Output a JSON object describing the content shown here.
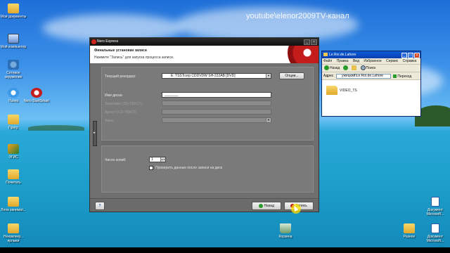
{
  "watermark": "youtube\\elenor2009TV-канал",
  "desktop_icons": [
    {
      "label": "Мои документы"
    },
    {
      "label": "Мой компьютер"
    },
    {
      "label": "Сетевое окружение"
    },
    {
      "label": "iTunes"
    },
    {
      "label": "Nero StartSmart"
    },
    {
      "label": "Прогр"
    },
    {
      "label": "ЭГИС"
    },
    {
      "label": "Почитать"
    },
    {
      "label": "Лена занимат..."
    },
    {
      "label": "Неизвлеку... ярлыки"
    },
    {
      "label": "Корзина"
    },
    {
      "label": "Разное"
    },
    {
      "label": "Документ Microsoft..."
    },
    {
      "label": "Документ Microsoft..."
    }
  ],
  "nero": {
    "title": "Nero Express",
    "header_title": "Финальные установки записи",
    "header_subtitle": "Нажмите \"Запись\" для запуска процесса записи.",
    "recorder_label": "Текущий рекордер:",
    "recorder_value": "E: TSSTcorp CDDVDW SH-222AB   [DVD]",
    "options_button": "Опции...",
    "disc_name_label": "Имя диска:",
    "disc_name_value": "_______",
    "title_label": "Заголовок (CD-ТЕКСТ)",
    "artist_label": "Артист (CD-ТЕКСТ)",
    "lang_label": "Язык:",
    "copies_label": "Число копий:",
    "copies_value": "1",
    "verify_label": "Проверить данные после записи на диск",
    "help_button": "?",
    "back_button": "Назад",
    "burn_button": "Запись"
  },
  "explorer": {
    "title": "Le.Roi.de.Lahore",
    "menu": [
      "Файл",
      "Правка",
      "Вид",
      "Избранное",
      "Сервис",
      "Справка"
    ],
    "toolbar": {
      "back": "Назад",
      "search": "Поиск"
    },
    "address_label": "Адрес",
    "address_value": "ужецкий\\Le.Roi.de.Lahore",
    "go_button": "Переход",
    "folder_name": "VIDEO_TS"
  },
  "colors": {
    "nero_panel": "#7a7a7a",
    "nero_accent": "#c41b1b",
    "explorer_title": "#0a3fb0"
  }
}
